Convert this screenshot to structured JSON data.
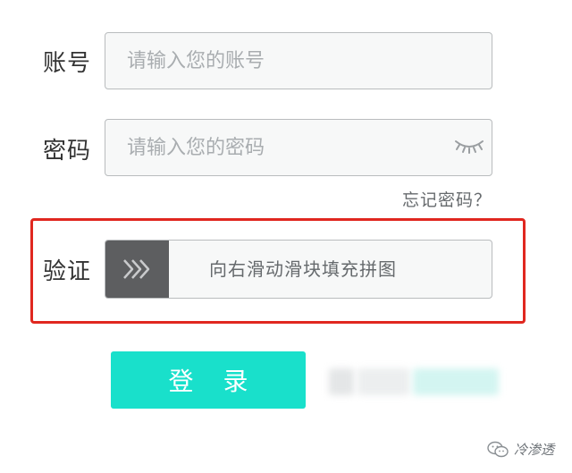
{
  "account": {
    "label": "账号",
    "placeholder": "请输入您的账号",
    "value": ""
  },
  "password": {
    "label": "密码",
    "placeholder": "请输入您的密码",
    "value": "",
    "toggle_icon": "eye-closed-icon"
  },
  "forgot_link": "忘记密码？",
  "verify": {
    "label": "验证",
    "slider_text": "向右滑动滑块填充拼图",
    "handle_icon": "triple-chevron-right-icon",
    "progress": 0
  },
  "login_button": "登 录",
  "watermark": {
    "text": "冷渗透",
    "icon": "wechat-icon"
  },
  "colors": {
    "accent": "#19e0cb",
    "highlight": "#e0271f",
    "handle": "#5d5e60"
  }
}
